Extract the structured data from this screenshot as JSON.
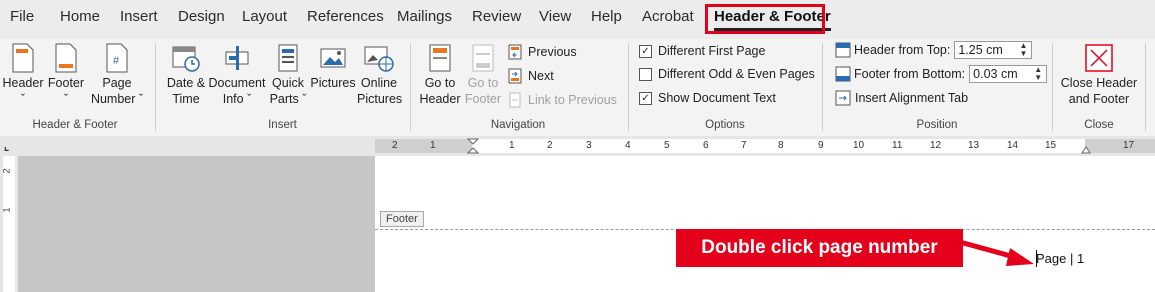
{
  "menu": {
    "tabs": [
      "File",
      "Home",
      "Insert",
      "Design",
      "Layout",
      "References",
      "Mailings",
      "Review",
      "View",
      "Help",
      "Acrobat"
    ],
    "active_tab": "Header & Footer"
  },
  "ribbon": {
    "header_footer_group": {
      "header": "Header",
      "footer": "Footer",
      "page_number_1": "Page",
      "page_number_2": "Number",
      "label": "Header & Footer"
    },
    "insert_group": {
      "date_time_1": "Date &",
      "date_time_2": "Time",
      "doc_info_1": "Document",
      "doc_info_2": "Info",
      "quick_parts_1": "Quick",
      "quick_parts_2": "Parts",
      "pictures": "Pictures",
      "online_pictures_1": "Online",
      "online_pictures_2": "Pictures",
      "label": "Insert"
    },
    "navigation_group": {
      "goto_header_1": "Go to",
      "goto_header_2": "Header",
      "goto_footer_1": "Go to",
      "goto_footer_2": "Footer",
      "previous": "Previous",
      "next": "Next",
      "link_to_previous": "Link to Previous",
      "label": "Navigation"
    },
    "options_group": {
      "different_first_page": "Different First Page",
      "different_odd_even": "Different Odd & Even Pages",
      "show_document_text": "Show Document Text",
      "label": "Options"
    },
    "position_group": {
      "header_from_top_label": "Header from Top:",
      "header_from_top_value": "1.25 cm",
      "footer_from_bottom_label": "Footer from Bottom:",
      "footer_from_bottom_value": "0.03 cm",
      "insert_alignment_tab": "Insert Alignment Tab",
      "label": "Position"
    },
    "close_group": {
      "close_1": "Close Header",
      "close_2": "and Footer",
      "label": "Close"
    }
  },
  "ruler": {
    "numbers": [
      "2",
      "1",
      "1",
      "2",
      "3",
      "4",
      "5",
      "6",
      "7",
      "8",
      "9",
      "10",
      "11",
      "12",
      "13",
      "14",
      "15",
      "17"
    ],
    "vertical": [
      "2",
      "1"
    ]
  },
  "document": {
    "footer_tag": "Footer",
    "page_number_text": "Page | 1"
  },
  "annotation": {
    "callout_text": "Double click page number",
    "color": "#e4001b"
  },
  "colors": {
    "accent_red": "#e4001b",
    "icon_blue": "#2b6cb0",
    "icon_orange": "#e87722"
  }
}
